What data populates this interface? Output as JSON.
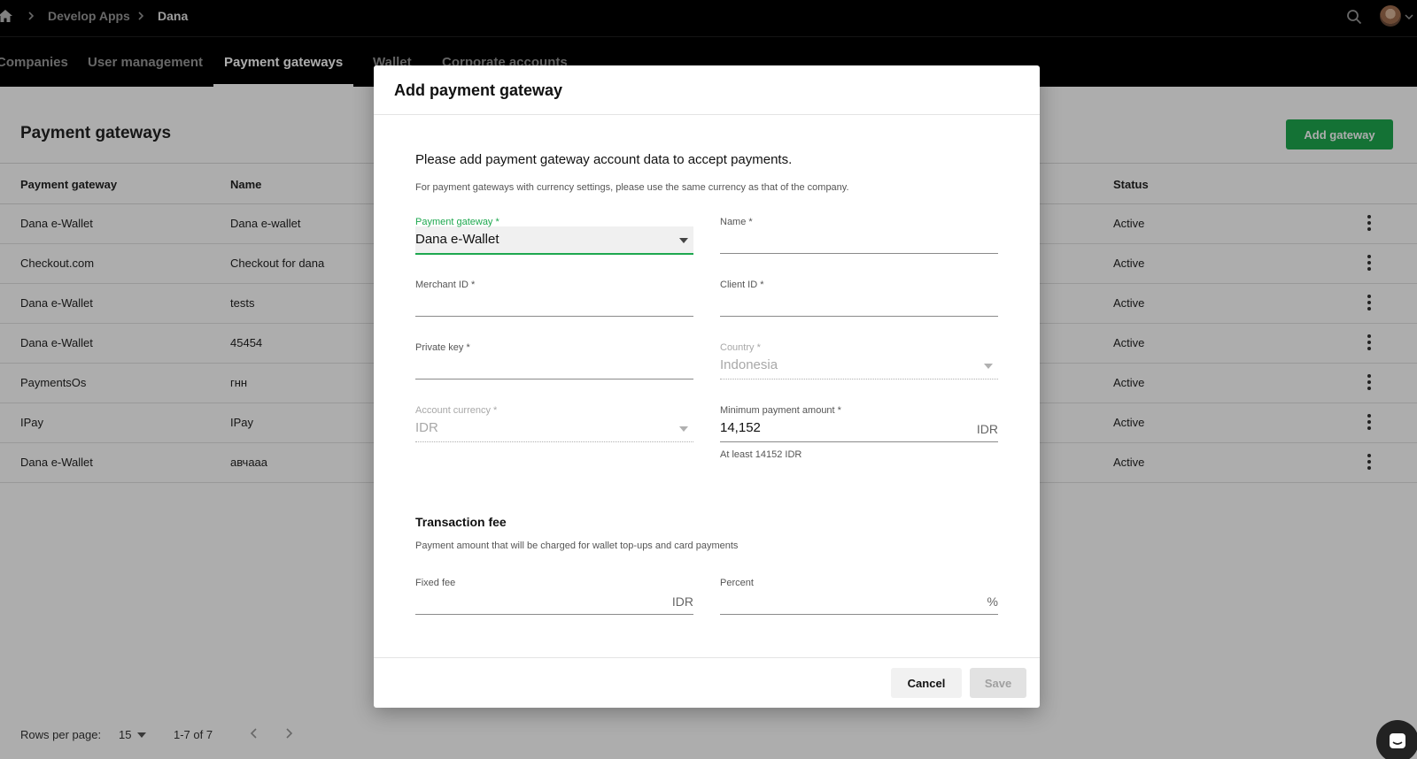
{
  "breadcrumb": {
    "items": [
      "Develop Apps",
      "Dana"
    ]
  },
  "tabs": [
    "Companies",
    "User management",
    "Payment gateways",
    "Wallet",
    "Corporate accounts"
  ],
  "page": {
    "title": "Payment gateways",
    "add_button": "Add gateway",
    "columns": [
      "Payment gateway",
      "Name",
      "Status"
    ],
    "rows": [
      {
        "gateway": "Dana e-Wallet",
        "name": "Dana e-wallet",
        "status": "Active"
      },
      {
        "gateway": "Checkout.com",
        "name": "Checkout for dana",
        "status": "Active"
      },
      {
        "gateway": "Dana e-Wallet",
        "name": "tests",
        "status": "Active"
      },
      {
        "gateway": "Dana e-Wallet",
        "name": "45454",
        "status": "Active"
      },
      {
        "gateway": "PaymentsOs",
        "name": "гнн",
        "status": "Active"
      },
      {
        "gateway": "IPay",
        "name": "IPay",
        "status": "Active"
      },
      {
        "gateway": "Dana e-Wallet",
        "name": "авчааа",
        "status": "Active"
      }
    ],
    "footer": {
      "rows_per_page_label": "Rows per page:",
      "rows_per_page": "15",
      "range": "1-7 of 7"
    }
  },
  "dialog": {
    "title": "Add payment gateway",
    "intro": "Please add payment gateway account data to accept payments.",
    "hint": "For payment gateways with currency settings, please use the same currency as that of the company.",
    "fields": {
      "payment_gateway": {
        "label": "Payment gateway *",
        "value": "Dana e-Wallet"
      },
      "name": {
        "label": "Name *",
        "value": ""
      },
      "merchant_id": {
        "label": "Merchant ID *",
        "value": ""
      },
      "client_id": {
        "label": "Client ID *",
        "value": ""
      },
      "private_key": {
        "label": "Private key *",
        "value": ""
      },
      "country": {
        "label": "Country *",
        "value": "Indonesia"
      },
      "account_currency": {
        "label": "Account currency *",
        "value": "IDR"
      },
      "min_payment": {
        "label": "Minimum payment amount *",
        "value": "14,152",
        "suffix": "IDR",
        "helper": "At least 14152 IDR"
      }
    },
    "transaction_fee": {
      "title": "Transaction fee",
      "hint": "Payment amount that will be charged for wallet top-ups and card payments",
      "fixed_fee": {
        "label": "Fixed fee",
        "value": "",
        "suffix": "IDR"
      },
      "percent": {
        "label": "Percent",
        "value": "",
        "suffix": "%"
      }
    },
    "cancel_label": "Cancel",
    "save_label": "Save"
  },
  "colors": {
    "accent": "#1ea84f",
    "topbar": "#000000"
  },
  "icons": [
    "home-icon",
    "chevron-right-icon",
    "search-icon",
    "avatar",
    "chevron-down-icon",
    "more-vert-icon",
    "chevron-left-icon",
    "chat-icon"
  ]
}
